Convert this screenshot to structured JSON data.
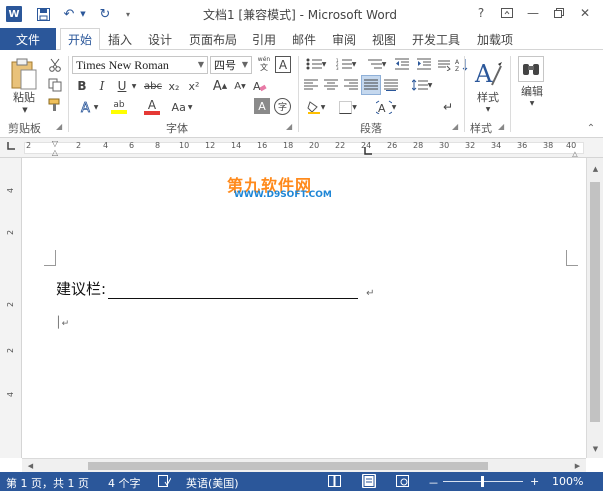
{
  "window": {
    "title": "文档1 [兼容模式] - Microsoft Word",
    "app_icon_letter": "W",
    "help_label": "?",
    "minimize_label": "—",
    "close_label": "✕"
  },
  "tabs": {
    "file": "文件",
    "items": [
      "开始",
      "插入",
      "设计",
      "页面布局",
      "引用",
      "邮件",
      "审阅",
      "视图",
      "开发工具",
      "加载项"
    ],
    "active_index": 0
  },
  "ribbon": {
    "clipboard": {
      "paste_label": "粘贴",
      "group_label": "剪贴板"
    },
    "font": {
      "font_name": "Times New Roman",
      "font_size": "四号",
      "group_label": "字体",
      "bold": "B",
      "italic": "I",
      "underline": "U",
      "strikethrough": "abc",
      "subscript": "x₂",
      "superscript": "x²",
      "grow": "A",
      "shrink": "A",
      "change_case": "Aa",
      "clear_format": "A",
      "phonetic": "wén",
      "border_char": "A",
      "highlight": "ab",
      "font_color": "A",
      "shading": "A",
      "enclose": "字"
    },
    "paragraph": {
      "group_label": "段落"
    },
    "styles": {
      "button_label": "样式",
      "group_label": "样式"
    },
    "editing": {
      "button_label": "编辑"
    }
  },
  "ruler": {
    "ticks": [
      "2",
      "2",
      "4",
      "6",
      "8",
      "10",
      "12",
      "14",
      "16",
      "18",
      "20",
      "22",
      "24",
      "26",
      "28",
      "30",
      "32",
      "34",
      "36",
      "38",
      "40"
    ],
    "vticks": [
      "4",
      "2",
      "2",
      "2",
      "4"
    ]
  },
  "watermark": {
    "cn": "第九软件网",
    "url": "WWW.D9SOFT.COM"
  },
  "document": {
    "line_label": "建议栏:",
    "para_mark": "↵"
  },
  "statusbar": {
    "page": "第 1 页，共 1 页",
    "words": "4 个字",
    "language": "英语(美国)",
    "zoom_minus": "－",
    "zoom_plus": "+",
    "zoom_level": "100%"
  },
  "colors": {
    "accent": "#2b579a",
    "highlight": "#ffff00",
    "font_color": "#e53935",
    "watermark_orange": "#ff8a1c",
    "watermark_blue": "#1e86d6"
  }
}
